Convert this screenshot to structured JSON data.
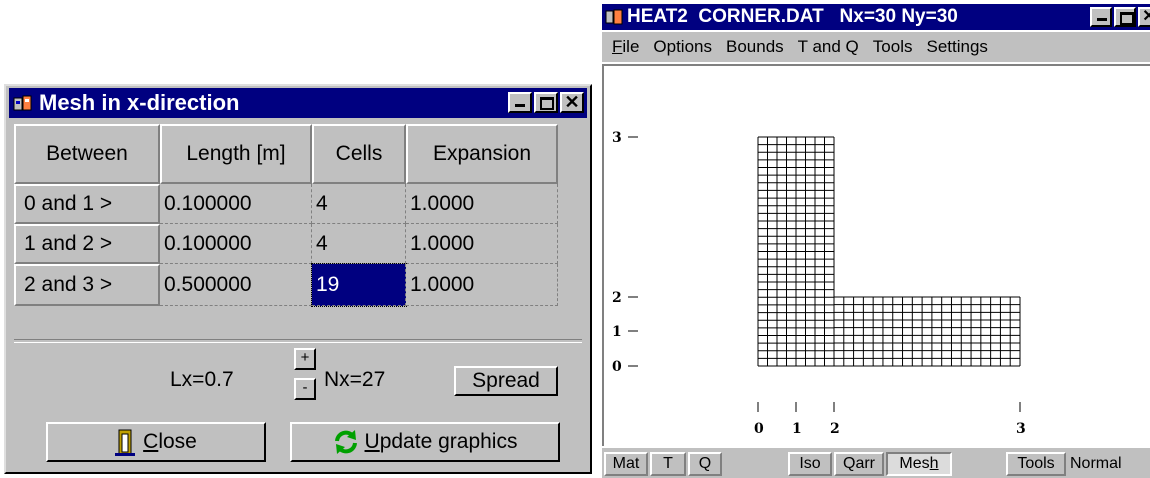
{
  "mesh_dialog": {
    "title": "Mesh in x-direction",
    "headers": [
      "Between",
      "Length [m]",
      "Cells",
      "Expansion"
    ],
    "rows": [
      {
        "label": "0 and 1 >",
        "length": "0.100000",
        "cells": "4",
        "expansion": "1.0000"
      },
      {
        "label": "1 and 2 >",
        "length": "0.100000",
        "cells": "4",
        "expansion": "1.0000"
      },
      {
        "label": "2 and 3 >",
        "length": "0.500000",
        "cells": "19",
        "expansion": "1.0000"
      }
    ],
    "lx": "Lx=0.7",
    "plus": "+",
    "minus": "-",
    "nx": "Nx=27",
    "spread": "Spread",
    "close_prefix": "",
    "close_mnemonic": "C",
    "close_rest": "lose",
    "update_mnemonic": "U",
    "update_rest": "pdate graphics"
  },
  "heat2": {
    "title": "HEAT2  CORNER.DAT   Nx=30 Ny=30",
    "menu": {
      "file_mn": "F",
      "file_rest": "ile",
      "options": "Options",
      "bounds": "Bounds",
      "tandq": "T and Q",
      "tools": "Tools",
      "settings": "Settings"
    },
    "y_ticks": [
      "3",
      "2",
      "1",
      "0"
    ],
    "x_ticks": [
      "0",
      "1",
      "2",
      "3"
    ],
    "bottom": {
      "mat": "Mat",
      "t": "T",
      "q": "Q",
      "iso": "Iso",
      "qarr": "Qarr",
      "mesh_pre": "Mes",
      "mesh_mn": "h",
      "tools": "Tools",
      "normal": "Normal"
    }
  },
  "colors": {
    "title_bar": "#000080",
    "face": "#c0c0c0",
    "selected_cell": "#000080"
  },
  "icons": [
    "app-icon",
    "minimize-icon",
    "maximize-icon",
    "close-icon",
    "door-icon",
    "refresh-icon"
  ]
}
